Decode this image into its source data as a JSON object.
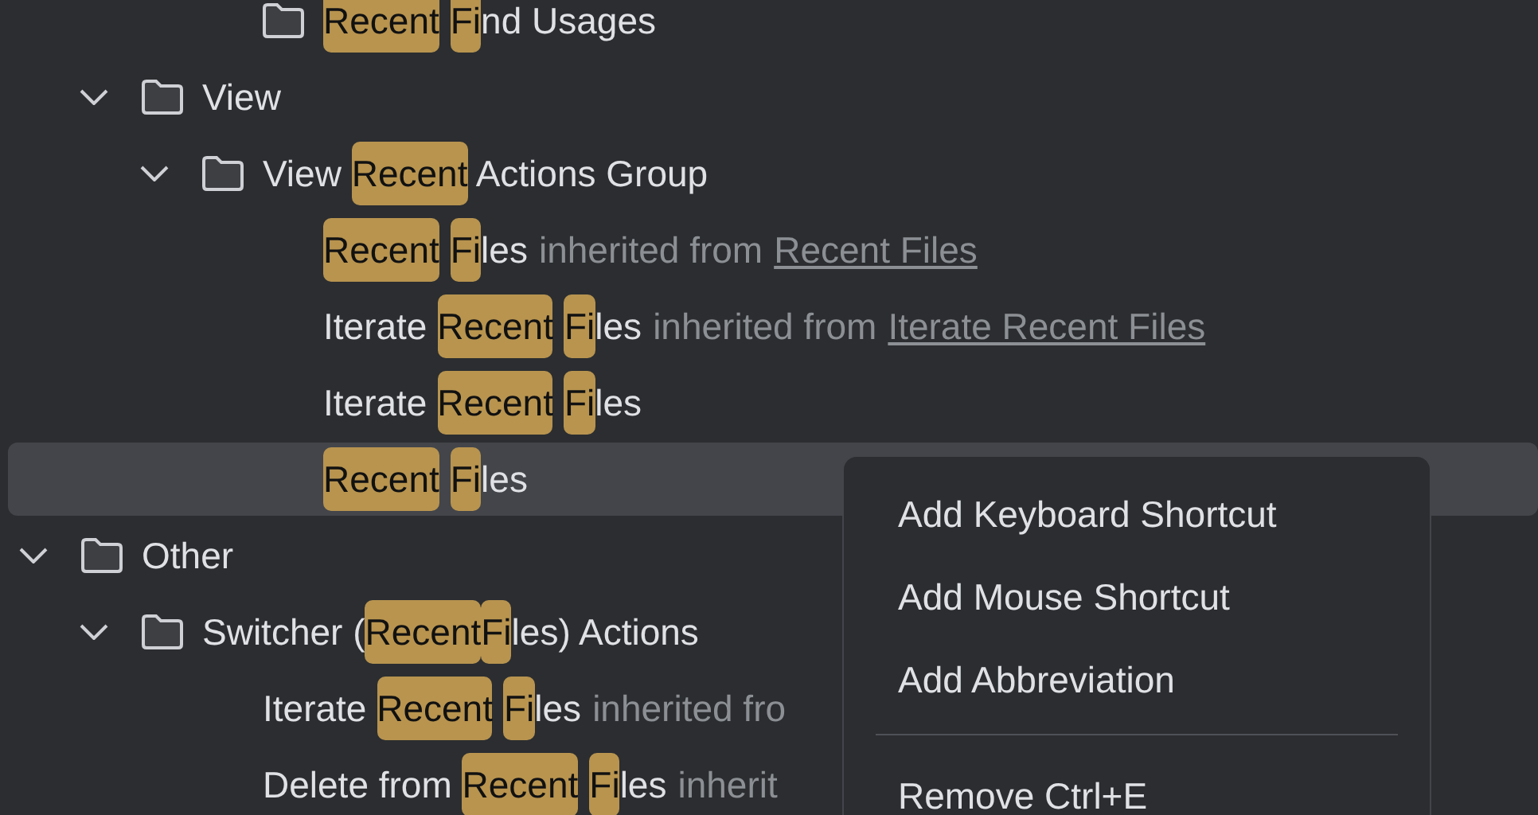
{
  "tree": [
    {
      "children": [
        {
          "children": [
            {
              "children": [
                {
                  "kind": "folder",
                  "parts": [
                    {
                      "text": "Recent",
                      "highlight": true,
                      "space_after": true
                    },
                    {
                      "text": "Fi",
                      "highlight": true
                    },
                    {
                      "text": "nd Usages",
                      "highlight": false
                    }
                  ]
                }
              ]
            }
          ]
        },
        {
          "kind": "folder",
          "expanded": true,
          "selected": false,
          "parts": [
            {
              "text": "View",
              "highlight": false
            }
          ],
          "children": [
            {
              "kind": "folder",
              "expanded": true,
              "selected": false,
              "parts": [
                {
                  "text": "View ",
                  "highlight": false
                },
                {
                  "text": "Recent",
                  "highlight": true
                },
                {
                  "text": " Actions Group",
                  "highlight": false
                }
              ],
              "children": [
                {
                  "kind": "action",
                  "selected": false,
                  "parts": [
                    {
                      "text": "Recent",
                      "highlight": true,
                      "space_after": true
                    },
                    {
                      "text": "Fi",
                      "highlight": true
                    },
                    {
                      "text": "les",
                      "highlight": false
                    }
                  ],
                  "inherited": {
                    "text": "inherited from",
                    "link": "Recent Files"
                  }
                },
                {
                  "kind": "action",
                  "selected": false,
                  "parts": [
                    {
                      "text": "Iterate ",
                      "highlight": false
                    },
                    {
                      "text": "Recent",
                      "highlight": true,
                      "space_after": true
                    },
                    {
                      "text": "Fi",
                      "highlight": true
                    },
                    {
                      "text": "les",
                      "highlight": false
                    }
                  ],
                  "inherited": {
                    "text": "inherited from",
                    "link": "Iterate Recent Files"
                  }
                },
                {
                  "kind": "action",
                  "selected": false,
                  "parts": [
                    {
                      "text": "Iterate ",
                      "highlight": false
                    },
                    {
                      "text": "Recent",
                      "highlight": true,
                      "space_after": true
                    },
                    {
                      "text": "Fi",
                      "highlight": true
                    },
                    {
                      "text": "les",
                      "highlight": false
                    }
                  ]
                },
                {
                  "kind": "action",
                  "selected": true,
                  "parts": [
                    {
                      "text": "Recent",
                      "highlight": true,
                      "space_after": true
                    },
                    {
                      "text": "Fi",
                      "highlight": true
                    },
                    {
                      "text": "les",
                      "highlight": false
                    }
                  ]
                }
              ]
            }
          ]
        }
      ]
    },
    {
      "kind": "folder",
      "expanded": true,
      "selected": false,
      "parts": [
        {
          "text": "Other",
          "highlight": false
        }
      ],
      "children": [
        {
          "kind": "folder",
          "expanded": true,
          "selected": false,
          "parts": [
            {
              "text": "Switcher (",
              "highlight": false
            },
            {
              "text": "Recent",
              "highlight": true
            },
            {
              "text": "Fi",
              "highlight": true
            },
            {
              "text": "les) Actions",
              "highlight": false
            }
          ],
          "children": [
            {
              "kind": "action",
              "selected": false,
              "parts": [
                {
                  "text": "Iterate ",
                  "highlight": false
                },
                {
                  "text": "Recent",
                  "highlight": true,
                  "space_after": true
                },
                {
                  "text": "Fi",
                  "highlight": true
                },
                {
                  "text": "les",
                  "highlight": false
                }
              ],
              "inherited": {
                "text": "inherited fro"
              }
            },
            {
              "kind": "action",
              "selected": false,
              "parts": [
                {
                  "text": "Delete from ",
                  "highlight": false
                },
                {
                  "text": "Recent",
                  "highlight": true,
                  "space_after": true
                },
                {
                  "text": "Fi",
                  "highlight": true
                },
                {
                  "text": "les",
                  "highlight": false
                }
              ],
              "inherited": {
                "text": "inherit"
              }
            }
          ]
        }
      ]
    }
  ],
  "context_menu": {
    "items": [
      {
        "kind": "item",
        "label": "Add Keyboard Shortcut"
      },
      {
        "kind": "item",
        "label": "Add Mouse Shortcut"
      },
      {
        "kind": "item",
        "label": "Add Abbreviation"
      },
      {
        "kind": "separator"
      },
      {
        "kind": "item",
        "label": "Remove Ctrl+E"
      }
    ]
  }
}
